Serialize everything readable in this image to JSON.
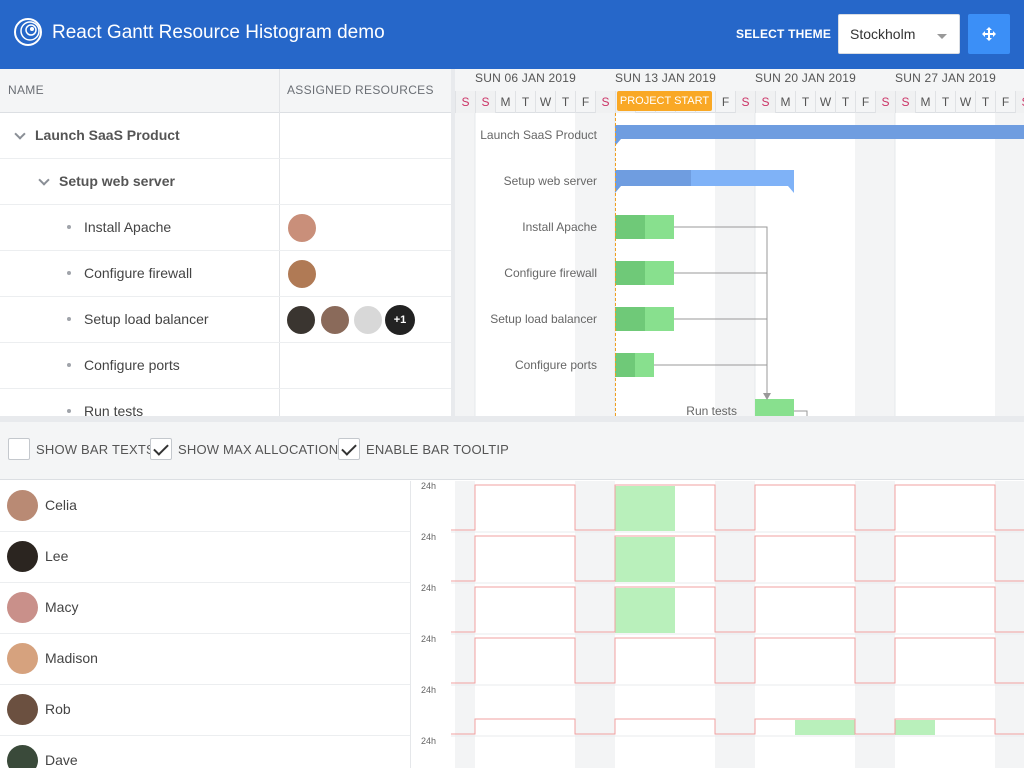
{
  "header": {
    "title": "React Gantt Resource Histogram demo",
    "theme_label": "SELECT THEME",
    "theme_value": "Stockholm",
    "fullscreen_icon": "move-icon",
    "logo_icon": "spiral-logo-icon"
  },
  "grid": {
    "columns": [
      "NAME",
      "ASSIGNED RESOURCES"
    ],
    "rows": [
      {
        "name": "Launch SaaS Product",
        "level": 0,
        "parent": true
      },
      {
        "name": "Setup web server",
        "level": 1,
        "parent": true
      },
      {
        "name": "Install Apache",
        "level": 2,
        "parent": false
      },
      {
        "name": "Configure firewall",
        "level": 2,
        "parent": false
      },
      {
        "name": "Setup load balancer",
        "level": 2,
        "parent": false
      },
      {
        "name": "Configure ports",
        "level": 2,
        "parent": false
      },
      {
        "name": "Run tests",
        "level": 2,
        "parent": false
      }
    ],
    "more_resources": "+1"
  },
  "timeline": {
    "weeks": [
      "SUN 06 JAN 2019",
      "SUN 13 JAN 2019",
      "SUN 20 JAN 2019",
      "SUN 27 JAN 2019"
    ],
    "days": [
      "S",
      "S",
      "M",
      "T",
      "W",
      "T",
      "F",
      "S",
      "S",
      "M",
      "T",
      "W",
      "T",
      "F",
      "S",
      "S",
      "M",
      "T",
      "W",
      "T",
      "F",
      "S",
      "S",
      "M",
      "T",
      "W",
      "T",
      "F",
      "S"
    ],
    "project_start": "PROJECT START"
  },
  "toolbar": {
    "show_bar_texts": {
      "label": "SHOW BAR TEXTS",
      "checked": false
    },
    "show_max_allocation": {
      "label": "SHOW MAX ALLOCATION",
      "checked": true
    },
    "enable_bar_tooltip": {
      "label": "ENABLE BAR TOOLTIP",
      "checked": true
    }
  },
  "resources": [
    {
      "name": "Celia",
      "axis": "24h"
    },
    {
      "name": "Lee",
      "axis": "24h"
    },
    {
      "name": "Macy",
      "axis": "24h"
    },
    {
      "name": "Madison",
      "axis": "24h"
    },
    {
      "name": "Rob",
      "axis": "24h"
    },
    {
      "name": "Dave",
      "axis": "24h"
    }
  ],
  "colors": {
    "header_bg": "#2667c9",
    "parent_bar": "#6f9de0",
    "task_bar": "#88e08e",
    "task_bar_done": "#6fc978",
    "project_start": "#f9a825",
    "alloc_fill": "#b9f0bb",
    "max_line": "#f0a0a0"
  }
}
